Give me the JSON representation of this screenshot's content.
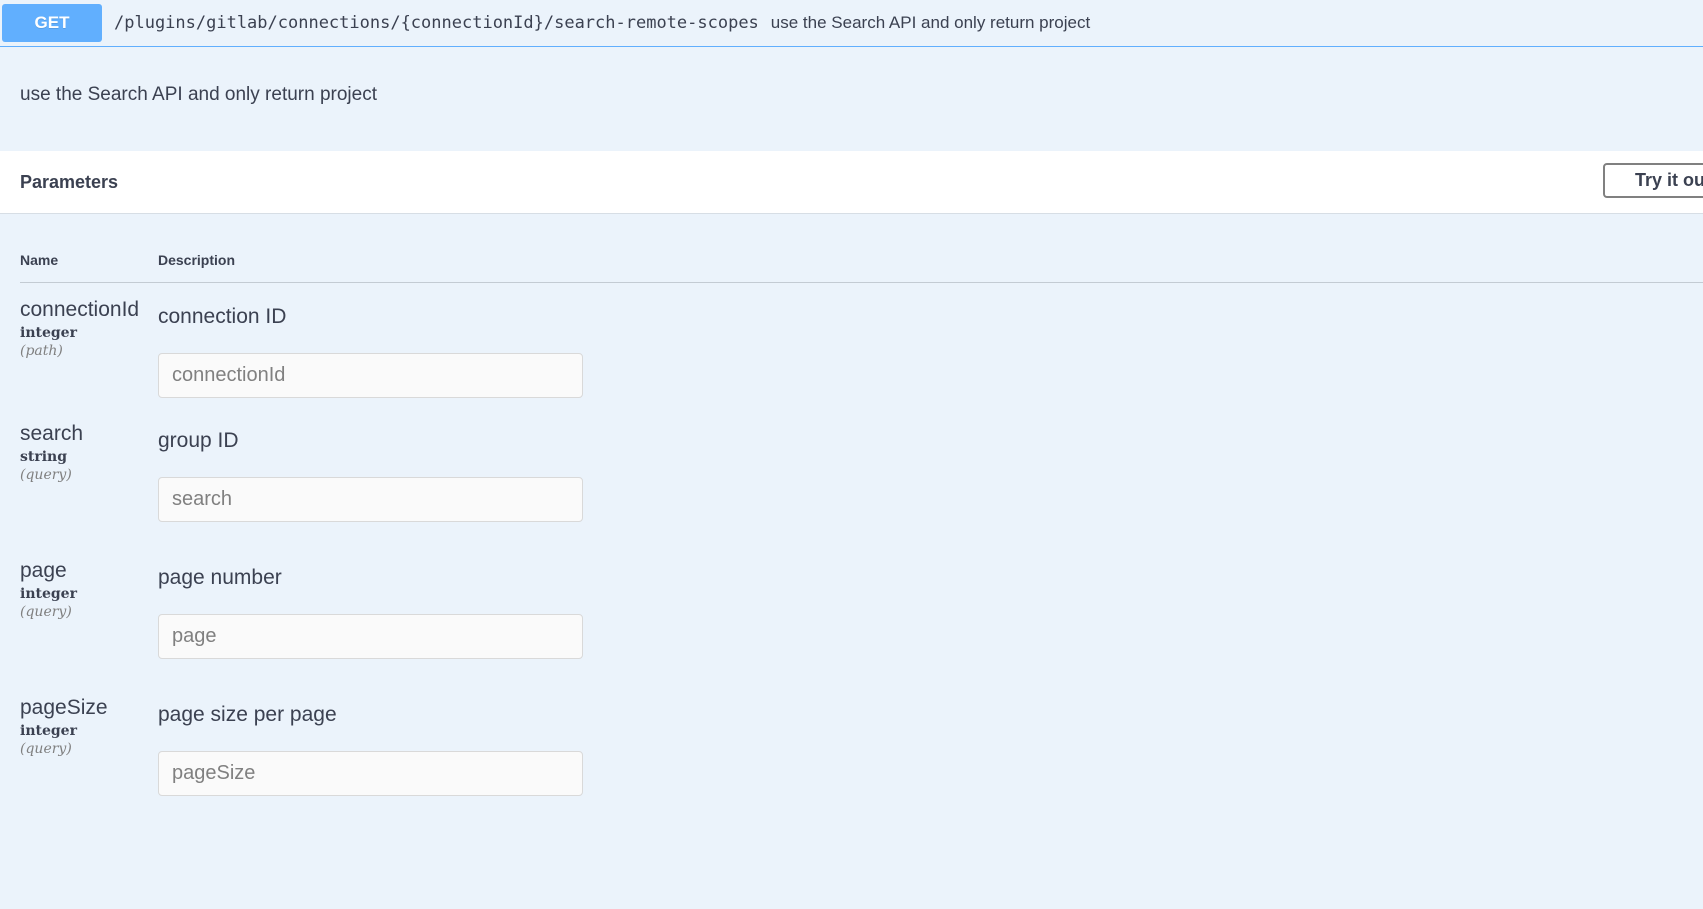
{
  "summary": {
    "method": "GET",
    "path": "/plugins/gitlab/connections/{connectionId}/search-remote-scopes",
    "description": "use the Search API and only return project"
  },
  "description": "use the Search API and only return project",
  "parameters": {
    "title": "Parameters",
    "try_button": "Try it ou",
    "columns": {
      "name": "Name",
      "description": "Description"
    },
    "items": [
      {
        "name": "connectionId",
        "type": "integer",
        "in": "(path)",
        "description": "connection ID",
        "placeholder": "connectionId"
      },
      {
        "name": "search",
        "type": "string",
        "in": "(query)",
        "description": "group ID",
        "placeholder": "search"
      },
      {
        "name": "page",
        "type": "integer",
        "in": "(query)",
        "description": "page number",
        "placeholder": "page"
      },
      {
        "name": "pageSize",
        "type": "integer",
        "in": "(query)",
        "description": "page size per page",
        "placeholder": "pageSize"
      }
    ]
  },
  "colors": {
    "accent": "#61affe",
    "background": "#ebf3fb",
    "text": "#3b4151"
  }
}
